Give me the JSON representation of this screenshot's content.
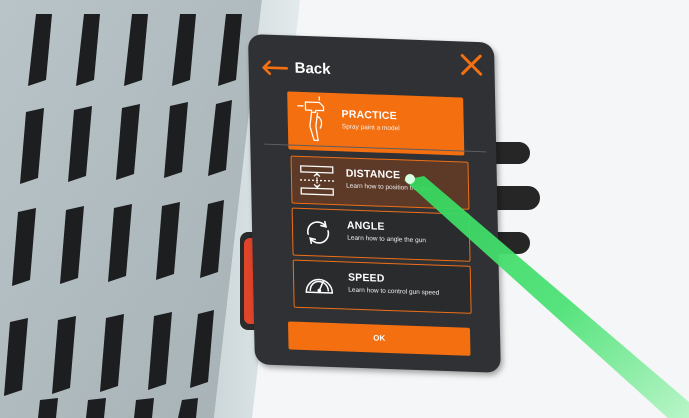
{
  "menu": {
    "back_label": "Back",
    "practice": {
      "title": "PRACTICE",
      "subtitle": "Spray paint a model",
      "icon": "spray-gun-icon"
    },
    "options": [
      {
        "title": "DISTANCE",
        "subtitle": "Learn how to position the gun",
        "icon": "distance-icon",
        "active": true
      },
      {
        "title": "ANGLE",
        "subtitle": "Learn how to angle the gun",
        "icon": "angle-rotate-icon",
        "active": false
      },
      {
        "title": "SPEED",
        "subtitle": "Learn how to control gun speed",
        "icon": "speedometer-icon",
        "active": false
      }
    ],
    "ok_label": "OK"
  },
  "colors": {
    "accent": "#f36f10",
    "panel": "#2f3134",
    "laser": "#3de06a",
    "active_option": "#5c3a27"
  }
}
